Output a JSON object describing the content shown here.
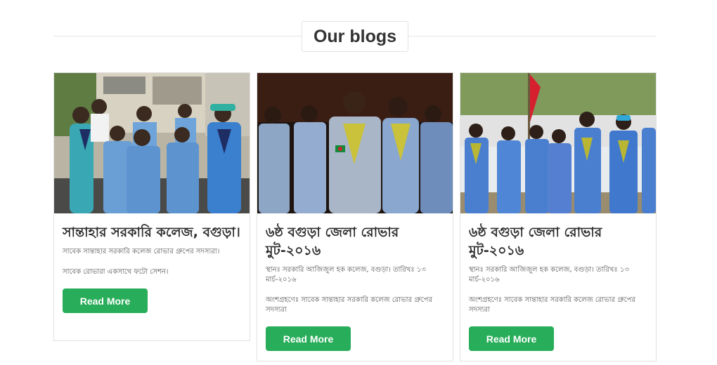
{
  "section": {
    "title": "Our blogs"
  },
  "blogs": [
    {
      "title": "সান্তাহার সরকারি কলেজ, বগুড়া।",
      "paragraph1": "সাবেক সান্তাহার সরকারি কলেজ রোভার গ্রুপের সদস্যরা।",
      "paragraph2": "সাবেক রোভারা একসাথে ফটো সেশন।",
      "button": "Read More",
      "image": "Group photo of scouts outside a college building"
    },
    {
      "title": "৬ষ্ঠ বগুড়া জেলা রোভার মুট-২০১৬",
      "paragraph1": "স্থানঃ সরকারি আজিজুল হক কলেজ, বগুড়া। তারিখঃ ১৩ মার্চ-২০১৬",
      "paragraph2": "অংশগ্রহণেঃ সাবেক সান্তাহার সরকারি কলেজ রোভার গ্রুপের সদস্যরা",
      "button": "Read More",
      "image": "Rover scouts standing together at night"
    },
    {
      "title": "৬ষ্ঠ বগুড়া জেলা রোভার মুট-২০১৬",
      "paragraph1": "স্থানঃ সরকারি আজিজুল হক কলেজ, বগুড়া। তারিখঃ ১৩ মার্চ-২০১৬",
      "paragraph2": "অংশগ্রহণেঃ সাবেক সান্তাহার সরকারি কলেজ রোভার গ্রুপের সদস্যরা",
      "button": "Read More",
      "image": "Line of rover scouts with a red flag outdoors"
    }
  ],
  "colors": {
    "button": "#28ad5a",
    "border": "#e2e2e2",
    "heading": "#333333"
  }
}
